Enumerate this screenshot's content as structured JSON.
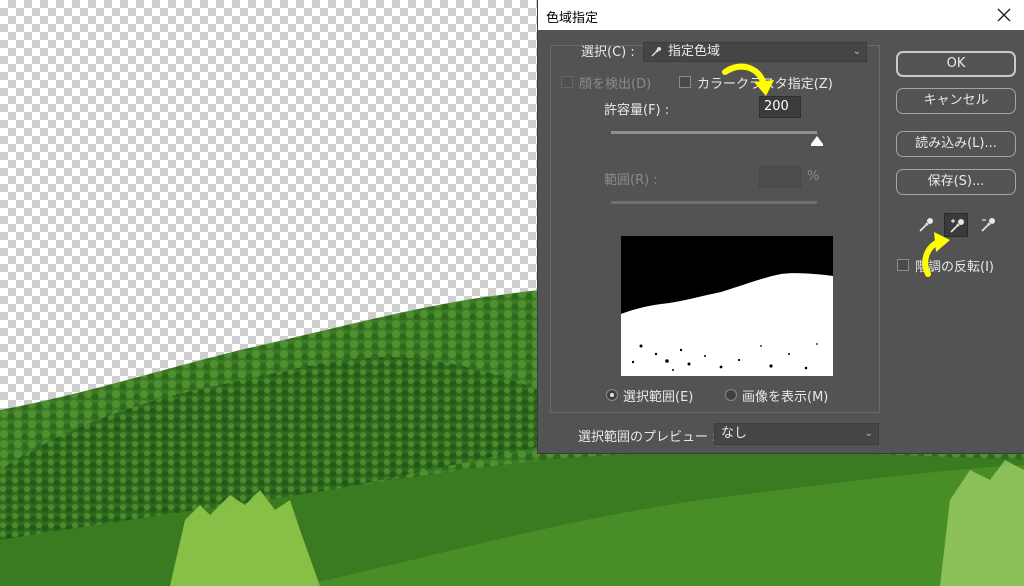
{
  "dialog": {
    "title": "色域指定",
    "select_label": "選択(C) :",
    "select_value": "指定色域",
    "detect_faces_label": "顔を検出(D)",
    "localized_clusters_label": "カラークラスタ指定(Z)",
    "fuzziness_label": "許容量(F) :",
    "fuzziness_value": "200",
    "range_label": "範囲(R) :",
    "range_value": "",
    "range_unit": "%",
    "radio_selection": "選択範囲(E)",
    "radio_image": "画像を表示(M)",
    "selected_view": "selection",
    "preview_label": "選択範囲のプレビュー :",
    "preview_value": "なし",
    "invert_label": "階調の反転(I)",
    "buttons": {
      "ok": "OK",
      "cancel": "キャンセル",
      "load": "読み込み(L)...",
      "save": "保存(S)..."
    },
    "fuzziness_slider_fraction": 1.0,
    "eyedroppers": [
      "eyedropper-icon",
      "eyedropper-plus-icon",
      "eyedropper-minus-icon"
    ],
    "active_eyedropper": "eyedropper-plus-icon"
  },
  "colors": {
    "dialog_bg": "#535353",
    "annotation_arrow": "#ffff00"
  }
}
